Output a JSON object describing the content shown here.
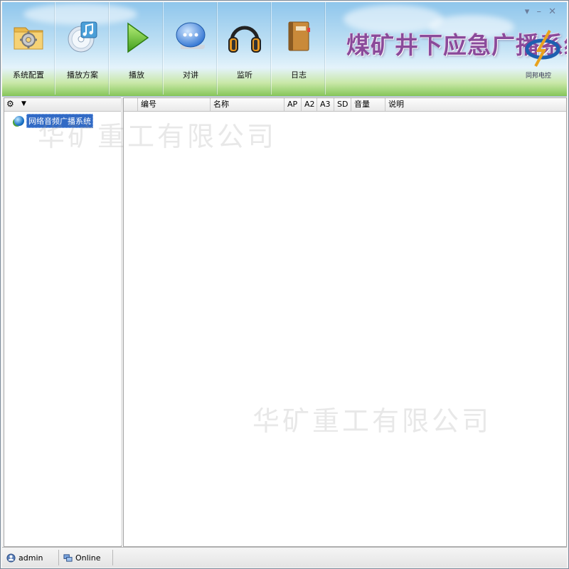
{
  "window": {
    "title": "煤矿井下应急广播系统",
    "controls": [
      "▾",
      "–",
      "✕"
    ],
    "logo_text": "同邦电控"
  },
  "toolbar": {
    "buttons": [
      {
        "label": "系统配置",
        "icon": "settings-folder-icon"
      },
      {
        "label": "播放方案",
        "icon": "music-cd-icon"
      },
      {
        "label": "播放",
        "icon": "play-icon"
      },
      {
        "label": "对讲",
        "icon": "chat-bubble-icon"
      },
      {
        "label": "监听",
        "icon": "headphones-icon"
      },
      {
        "label": "日志",
        "icon": "log-book-icon"
      }
    ]
  },
  "tree": {
    "items": [
      {
        "label": "网络音频广播系统",
        "selected": true
      }
    ]
  },
  "grid": {
    "columns": [
      "",
      "编号",
      "名称",
      "AP",
      "A2",
      "A3",
      "SD",
      "音量",
      "说明"
    ]
  },
  "watermark": "华矿重工有限公司",
  "status": {
    "user": "admin",
    "connection": "Online"
  },
  "colors": {
    "title_purple": "#8a4a9a",
    "selection_blue": "#316ac5"
  }
}
